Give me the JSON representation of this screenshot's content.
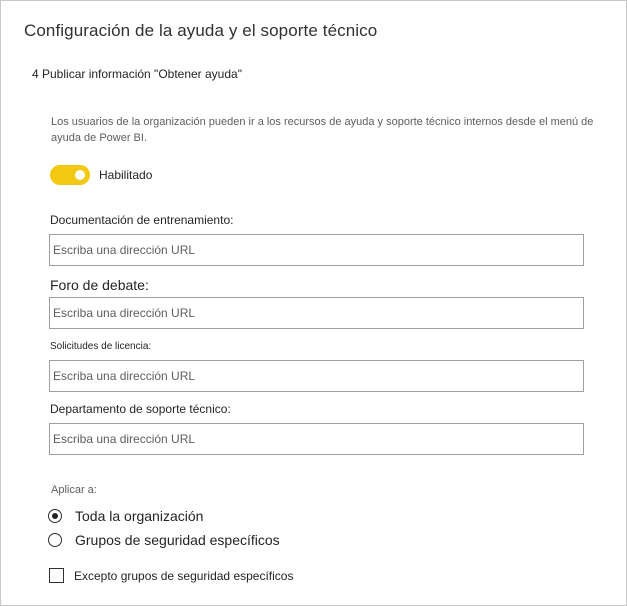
{
  "header": {
    "title": "Configuración de la ayuda y el soporte técnico"
  },
  "section": {
    "title": "4 Publicar información \"Obtener ayuda\"",
    "description": "Los usuarios de la organización pueden ir a los recursos de ayuda y soporte técnico internos desde el menú de ayuda de Power BI."
  },
  "toggle": {
    "label": "Habilitado",
    "enabled": true,
    "color": "#f2c811"
  },
  "fields": [
    {
      "label": "Documentación de entrenamiento:",
      "placeholder": "Escriba una dirección URL",
      "value": ""
    },
    {
      "label": "Foro de debate:",
      "placeholder": "Escriba una dirección URL",
      "value": ""
    },
    {
      "label": "Solicitudes de licencia:",
      "placeholder": "Escriba una dirección URL",
      "value": ""
    },
    {
      "label": "Departamento de soporte técnico:",
      "placeholder": "Escriba una dirección URL",
      "value": ""
    }
  ],
  "apply": {
    "label": "Aplicar a:",
    "options": [
      {
        "label": "Toda la organización",
        "selected": true
      },
      {
        "label": "Grupos de seguridad específicos",
        "selected": false
      }
    ],
    "except": {
      "label": "Excepto grupos de seguridad específicos",
      "checked": false
    }
  }
}
